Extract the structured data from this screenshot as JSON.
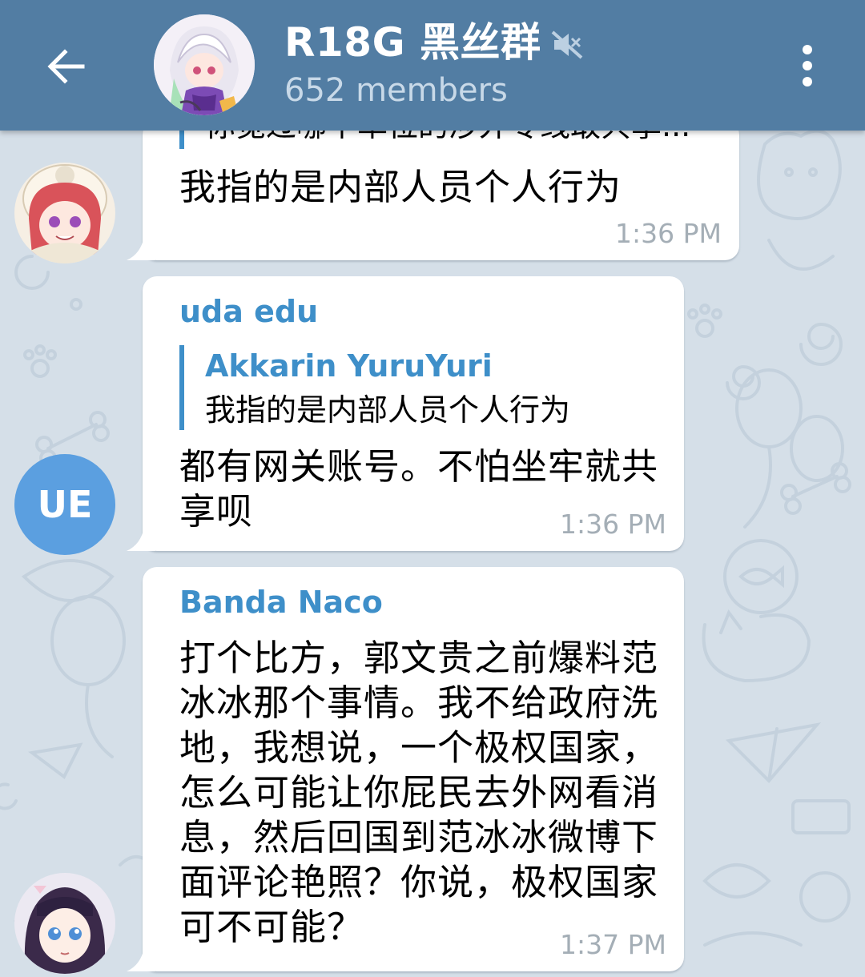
{
  "header": {
    "back_icon": "arrow-left-icon",
    "title": "R18G 黑丝群",
    "members": "652 members",
    "mute_icon": "muted-speaker-icon",
    "menu_icon": "more-vertical-icon"
  },
  "messages": [
    {
      "reply_text_cut": "你觉过哪个单位的涉外专线敢共享...",
      "text": "我指的是内部人员个人行为",
      "time": "1:36 PM"
    },
    {
      "sender": "uda edu",
      "avatar_initials": "UE",
      "reply": {
        "name": "Akkarin YuruYuri",
        "text": "我指的是内部人员个人行为"
      },
      "text_lines": [
        "都有网关账号。不怕坐牢就共",
        "享呗"
      ],
      "time": "1:36 PM"
    },
    {
      "sender": "Banda Naco",
      "text_lines": [
        "打个比方，郭文贵之前爆料范",
        "冰冰那个事情。我不给政府洗",
        "地，我想说，一个极权国家，",
        "怎么可能让你屁民去外网看消",
        "息，然后回国到范冰冰微博下",
        "面评论艳照？你说，极权国家",
        "可不可能？"
      ],
      "time": "1:37 PM"
    }
  ],
  "colors": {
    "header_bg": "#527da3",
    "sender_name": "#3e8fc9",
    "chat_bg": "#d5dfe8",
    "avatar_ue": "#5b9fe0"
  }
}
